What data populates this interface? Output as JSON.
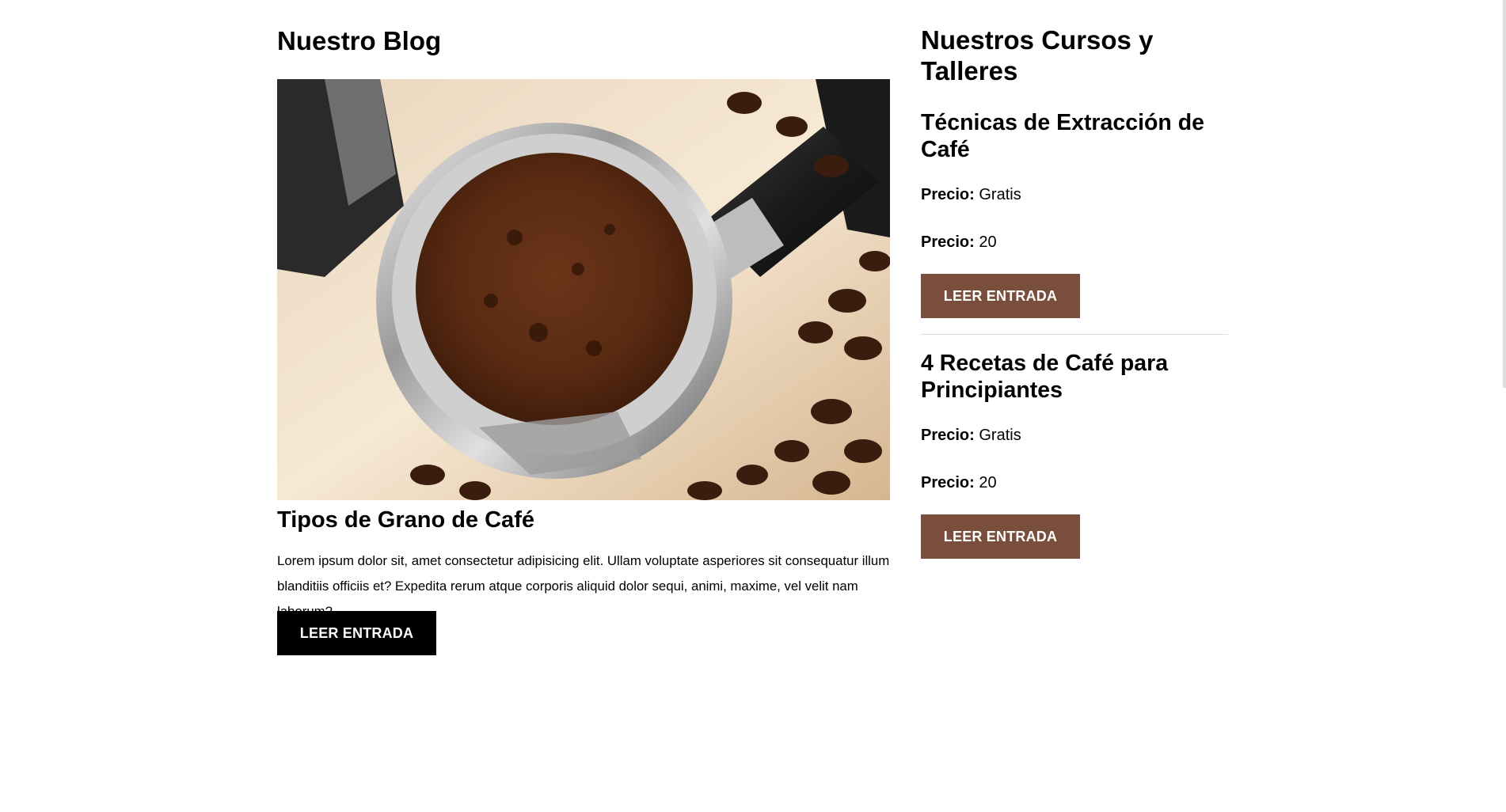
{
  "blog": {
    "heading": "Nuestro Blog",
    "image_alt": "coffee-portafilter-photo",
    "post": {
      "title": "Tipos de Grano de Café",
      "excerpt": "Lorem ipsum dolor sit, amet consectetur adipisicing elit. Ullam voluptate asperiores sit consequatur illum blanditiis officiis et? Expedita rerum atque corporis aliquid dolor sequi, animi, maxime, vel velit nam laborum?",
      "button": "LEER ENTRADA"
    }
  },
  "courses": {
    "heading": "Nuestros Cursos y Talleres",
    "items": [
      {
        "title": "Técnicas de Extracción de Café",
        "price_label": "Precio:",
        "price_1": "Gratis",
        "price_2": "20",
        "button": "LEER ENTRADA"
      },
      {
        "title": "4 Recetas de Café para Principiantes",
        "price_label": "Precio:",
        "price_1": "Gratis",
        "price_2": "20",
        "button": "LEER ENTRADA"
      }
    ]
  },
  "colors": {
    "brown_button": "#7a4e3c",
    "black_button": "#000000",
    "text": "#000000",
    "background": "#ffffff"
  }
}
